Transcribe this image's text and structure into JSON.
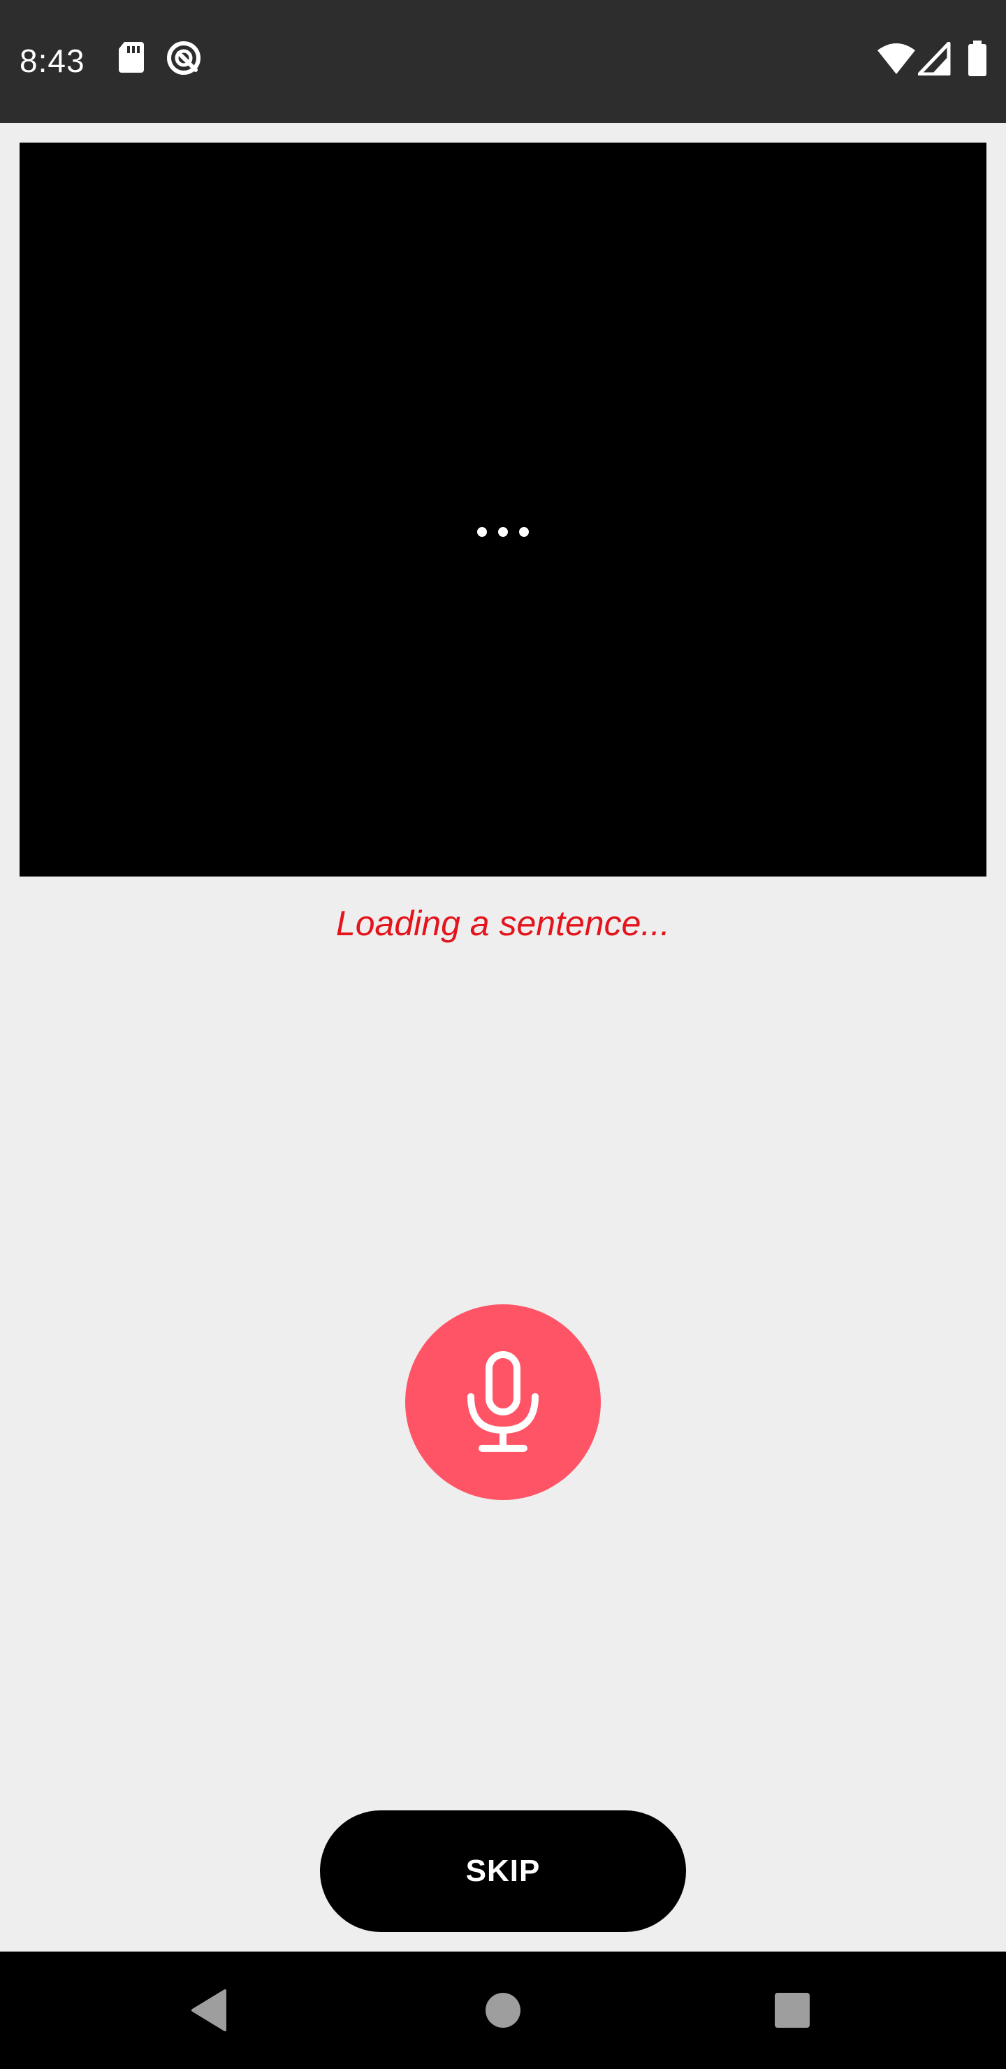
{
  "status_bar": {
    "time": "8:43",
    "icons_left": [
      "sd-card-icon",
      "data-saver-icon"
    ],
    "icons_right": [
      "wifi-icon",
      "signal-icon",
      "battery-icon"
    ]
  },
  "video": {
    "state_icon": "more-horizontal-icon"
  },
  "sentence": {
    "text": "Loading a sentence...",
    "color": "#e3141c"
  },
  "record": {
    "icon": "microphone-icon",
    "color": "#ff5466"
  },
  "skip": {
    "label": "SKIP"
  },
  "nav": {
    "back": "back-icon",
    "home": "home-icon",
    "recents": "recents-icon"
  }
}
